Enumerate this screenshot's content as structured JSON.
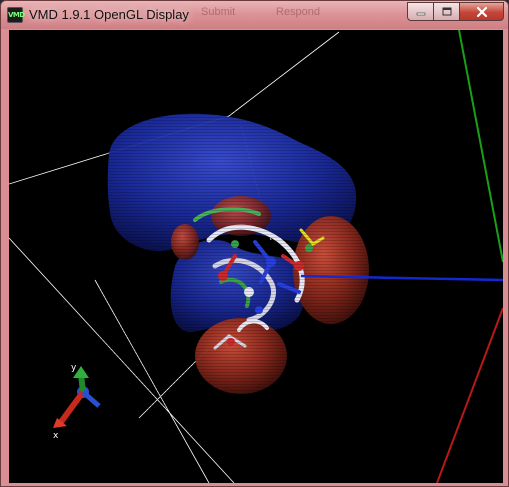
{
  "window": {
    "title": "VMD 1.9.1 OpenGL Display",
    "icon_label": "VMD",
    "background_tabs": [
      "Submit",
      "Respond"
    ]
  },
  "caption_buttons": {
    "minimize_icon": "minimize-icon",
    "maximize_icon": "maximize-icon",
    "close_icon": "close-icon"
  },
  "axes_indicator": {
    "y_label": "y",
    "x_label": "x",
    "y_color": "#1f8a2a",
    "x_color": "#c62a1e",
    "z_color": "#2a4fd0"
  },
  "scene": {
    "background": "#000000",
    "surface_blue": "#1a2a9c",
    "surface_red": "#8e2a1e",
    "cell_line_color": "#ffffff",
    "axis_green": "#18a018",
    "axis_red": "#b81818",
    "axis_blue": "#1428d0"
  }
}
